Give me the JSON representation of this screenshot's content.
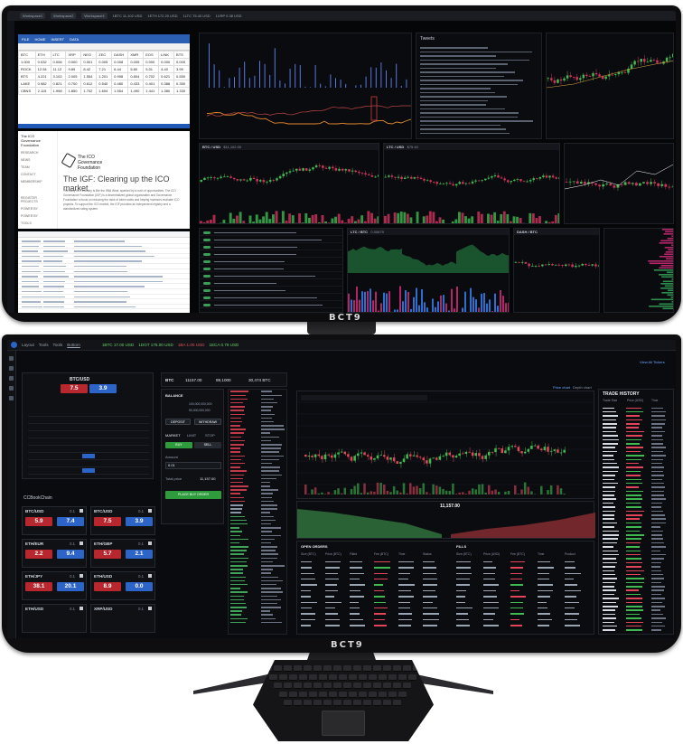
{
  "brand": {
    "logo_text": "BCT9"
  },
  "top_screen": {
    "topbar": {
      "tabs": [
        "Workspace1",
        "Workspace2",
        "Workspace3"
      ],
      "tickers": [
        "1BTC 11,102 USD",
        "1ETH 172.20 USD",
        "1LTC 75.40 USD",
        "1XRP 0.38 USD"
      ]
    },
    "excel": {
      "ribbon_items": [
        "FILE",
        "HOME",
        "INSERT",
        "DATA"
      ],
      "rows": [
        [
          "BTC",
          "ETH",
          "LTC",
          "XRP",
          "NEO",
          "ZEC",
          "DASH",
          "XMR",
          "EOS",
          "LINK",
          "BTS"
        ],
        [
          "1.000",
          "0.032",
          "0.006",
          "0.000",
          "0.001",
          "0.005",
          "0.008",
          "0.005",
          "0.000",
          "0.000",
          "0.000"
        ],
        [
          "ROCK",
          "12.54",
          "11.12",
          "9.89",
          "8.42",
          "7.21",
          "6.44",
          "5.80",
          "5.01",
          "4.40",
          "3.99"
        ],
        [
          "BTS",
          "4.221",
          "3.102",
          "2.005",
          "1.554",
          "1.201",
          "0.998",
          "0.804",
          "0.702",
          "0.621",
          "0.550"
        ],
        [
          "LAKE",
          "0.982",
          "0.821",
          "0.700",
          "0.612",
          "0.540",
          "0.480",
          "0.433",
          "0.401",
          "0.388",
          "0.350"
        ],
        [
          "CBNS",
          "2.115",
          "1.998",
          "1.850",
          "1.702",
          "1.604",
          "1.554",
          "1.490",
          "1.441",
          "1.380",
          "1.330"
        ]
      ]
    },
    "icg_site": {
      "logo_line1": "The ICO",
      "logo_line2": "Governance",
      "logo_line3": "Foundation",
      "nav": [
        "RESEARCH",
        "NEWS",
        "TEAM",
        "CONTACT",
        "MEMBERSHIP",
        "REGISTER PROJECTS",
        "POWER BY",
        "POWER BY",
        "TOOLS"
      ],
      "heading": "The IGF: Clearing up the ICO market",
      "paragraph": "The early ICO industry is like the Wild West, sparked by a rush of opportunities. The ICO Governance Foundation (IGF) is a decentralized global organization and Governance Foundation a focus on reducing the risks of token sales and helping investors evaluate ICO projects. To support the ICO market, the IGF provides an independent registry and a standardized rating system."
    },
    "news_panel": {
      "title": "Tweets"
    },
    "chart_headers": [
      {
        "pair": "BTC / USD",
        "price": "$11,102.00"
      },
      {
        "pair": "LTC / USD",
        "price": "$75.40"
      },
      {
        "pair": "LTC / BTC",
        "price": "0.00679"
      },
      {
        "pair": "DASH / BTC",
        "price": "0.0482"
      }
    ]
  },
  "bottom_screen": {
    "topbar": {
      "menus": [
        "Layout",
        "Tools",
        "Tools",
        "Bottom"
      ],
      "tickers": [
        {
          "label": "1BTC 17.00 USD",
          "color": "#6ad36a"
        },
        {
          "label": "1DGT 175.00 USD",
          "color": "#6ad36a"
        },
        {
          "label": "1BA 1.00 USD",
          "color": "#e35555"
        },
        {
          "label": "1ECA 0.79 USD",
          "color": "#6ad36a"
        }
      ]
    },
    "order_ticket": {
      "pair": "BTC/USD",
      "sell_price": "7.5",
      "buy_price": "3.9"
    },
    "tiles_title": "CCBookChain",
    "tiles": [
      {
        "name": "BTC/USD",
        "qty": "0.1",
        "sell": "5.9",
        "buy": "7.4"
      },
      {
        "name": "BTC/USD",
        "qty": "0.1",
        "sell": "7.5",
        "buy": "3.9"
      },
      {
        "name": "ETH/EUR",
        "qty": "0.1",
        "sell": "2.2",
        "buy": "9.4"
      },
      {
        "name": "ETH/GBP",
        "qty": "0.1",
        "sell": "5.7",
        "buy": "2.1"
      },
      {
        "name": "ETH/JPY",
        "qty": "0.1",
        "sell": "38.1",
        "buy": "20.1"
      },
      {
        "name": "ETH/USD",
        "qty": "0.1",
        "sell": "8.9",
        "buy": "0.0"
      },
      {
        "name": "ETH/USD",
        "qty": "0.1",
        "sell": "",
        "buy": ""
      },
      {
        "name": "XRP/USD",
        "qty": "0.1",
        "sell": "",
        "buy": ""
      }
    ],
    "balance": {
      "title": "BALANCE",
      "btc": "100,000,000,000",
      "usd": "50,000,000,000",
      "deposit": "DEPOSIT",
      "withdraw": "WITHDRAW",
      "order_types": [
        "MARKET",
        "LIMIT",
        "STOP"
      ],
      "buy": "BUY",
      "sell": "SELL",
      "amount_label": "Amount",
      "amount": "0.01",
      "total_label": "Total price",
      "total": "11,157.00",
      "place": "PLACE BUY ORDER"
    },
    "market_stats": {
      "pair": "BTC",
      "price": "11157.00",
      "change": "89,1000",
      "volume": "30,474 BTC"
    },
    "chart_tabs": {
      "price": "Price chart",
      "depth": "Depth chart"
    },
    "depth_mid": "11,157.00",
    "orders_title": "OPEN ORDERS",
    "fills_title": "FILLS",
    "order_cols": [
      "Size (BTC)",
      "Price (BTC)",
      "Filled",
      "Fee (BTC)",
      "Time",
      "Status"
    ],
    "fill_cols": [
      "Size (BTC)",
      "Price (USD)",
      "Fee (BTC)",
      "Time",
      "Product"
    ],
    "trade_history_title": "TRADE HISTORY",
    "trade_cols": [
      "Trade Size",
      "Price (USD)",
      "Time"
    ],
    "top_right_link": "View All Tickers"
  }
}
